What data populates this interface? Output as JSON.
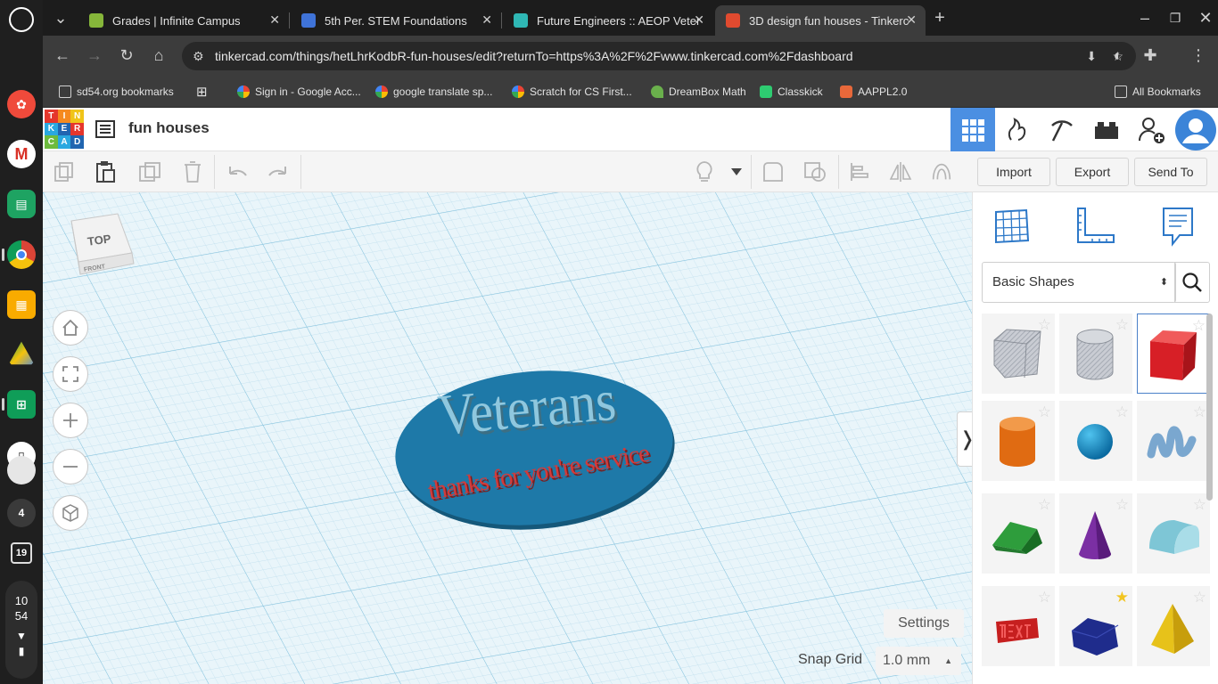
{
  "browser": {
    "tabs": [
      {
        "title": "Grades | Infinite Campus",
        "active": false,
        "favicon_color": "#86b63a"
      },
      {
        "title": "5th Per. STEM Foundations",
        "active": false,
        "favicon_color": "#3f73d8"
      },
      {
        "title": "Future Engineers :: AEOP Veter",
        "active": false,
        "favicon_color": "#2fb7b4"
      },
      {
        "title": "3D design fun houses - Tinkerc",
        "active": true,
        "favicon_color": "#e04a2f"
      }
    ],
    "url": "tinkercad.com/things/hetLhrKodbR-fun-houses/edit?returnTo=https%3A%2F%2Fwww.tinkercad.com%2Fdashboard",
    "bookmarks": [
      {
        "label": "sd54.org bookmarks",
        "icon": "folder-icon"
      },
      {
        "label": "Sign in - Google Acc...",
        "icon": "google-icon"
      },
      {
        "label": "google translate sp...",
        "icon": "google-icon"
      },
      {
        "label": "Scratch for CS First...",
        "icon": "google-icon"
      },
      {
        "label": "DreamBox Math",
        "icon": "dreambox-icon"
      },
      {
        "label": "Classkick",
        "icon": "classkick-icon"
      },
      {
        "label": "AAPPL2.0",
        "icon": "aappl-icon"
      }
    ],
    "all_bookmarks": "All Bookmarks"
  },
  "shelf": {
    "notification_count": "4",
    "calendar_day": "19",
    "clock_hour": "10",
    "clock_minute": "54"
  },
  "app": {
    "logo_letters": [
      "T",
      "I",
      "N",
      "K",
      "E",
      "R",
      "C",
      "A",
      "D"
    ],
    "logo_colors": [
      "#e5362c",
      "#f58a1f",
      "#f0c419",
      "#29a8e0",
      "#2165b0",
      "#e5362c",
      "#6dbb3e",
      "#29a8e0",
      "#2165b0"
    ],
    "design_title": "fun houses",
    "import_label": "Import",
    "export_label": "Export",
    "send_to_label": "Send To",
    "accent_color": "#1f77d4"
  },
  "workplane": {
    "viewcube_label": "TOP",
    "viewcube_front": "FRONT",
    "settings_label": "Settings",
    "snap_grid_label": "Snap Grid",
    "snap_grid_value": "1.0 mm",
    "model_text_main": "Veterans",
    "model_text_sub": "thanks for you're service",
    "model_base_color": "#1e79a8",
    "model_main_text_color": "#8fc7de",
    "model_sub_text_color": "#d23b3b"
  },
  "panel": {
    "shape_category": "Basic Shapes",
    "shapes": [
      {
        "name": "box-hole",
        "favorite": false
      },
      {
        "name": "cylinder-hole",
        "favorite": false
      },
      {
        "name": "box",
        "favorite": false
      },
      {
        "name": "cylinder",
        "favorite": false
      },
      {
        "name": "sphere",
        "favorite": false
      },
      {
        "name": "scribble",
        "favorite": false
      },
      {
        "name": "roof",
        "favorite": false
      },
      {
        "name": "cone",
        "favorite": false
      },
      {
        "name": "round-roof",
        "favorite": false
      },
      {
        "name": "text",
        "favorite": false
      },
      {
        "name": "polygon",
        "favorite": true
      },
      {
        "name": "pyramid",
        "favorite": false
      }
    ]
  }
}
